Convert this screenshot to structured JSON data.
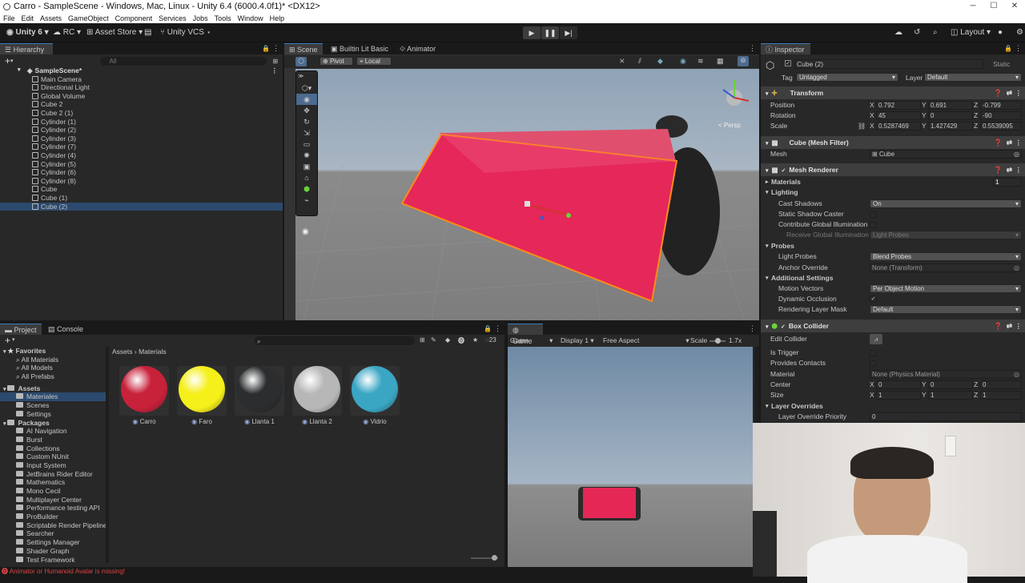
{
  "window": {
    "title": "Carro - SampleScene - Windows, Mac, Linux - Unity 6.4 (6000.4.0f1)* <DX12>"
  },
  "menu": [
    "File",
    "Edit",
    "Assets",
    "GameObject",
    "Component",
    "Services",
    "Jobs",
    "Tools",
    "Window",
    "Help"
  ],
  "toolbar": {
    "account": "Unity 6",
    "rc": "RC",
    "asset_store": "Asset Store",
    "vcs": "Unity VCS",
    "layout": "Layout"
  },
  "hierarchy": {
    "tab": "Hierarchy",
    "search_placeholder": "All",
    "scene": "SampleScene*",
    "items": [
      "Main Camera",
      "Directional Light",
      "Global Volume",
      "Cube 2",
      "Cube 2 (1)",
      "Cylinder (1)",
      "Cylinder (2)",
      "Cylinder (3)",
      "Cylinder (7)",
      "Cylinder (4)",
      "Cylinder (5)",
      "Cylinder (6)",
      "Cylinder (8)",
      "Cube",
      "Cube (1)",
      "Cube (2)"
    ]
  },
  "scene_view": {
    "tabs": [
      "Scene",
      "Builtin Lit Basic",
      "Animator"
    ],
    "pivot": "Pivot",
    "local": "Local",
    "persp": "< Persp"
  },
  "inspector": {
    "tab": "Inspector",
    "object_name": "Cube (2)",
    "static": "Static",
    "tag_label": "Tag",
    "tag": "Untagged",
    "layer_label": "Layer",
    "layer": "Default",
    "transform": {
      "title": "Transform",
      "position": {
        "label": "Position",
        "x": "0.792",
        "y": "0.691",
        "z": "-0.799"
      },
      "rotation": {
        "label": "Rotation",
        "x": "45",
        "y": "0",
        "z": "-90"
      },
      "scale": {
        "label": "Scale",
        "x": "0.5287469",
        "y": "1.427429",
        "z": "0.5539095"
      }
    },
    "mesh_filter": {
      "title": "Cube (Mesh Filter)",
      "mesh_label": "Mesh",
      "mesh": "Cube"
    },
    "mesh_renderer": {
      "title": "Mesh Renderer",
      "materials": "Materials",
      "materials_count": "1",
      "lighting": "Lighting",
      "cast_shadows_label": "Cast Shadows",
      "cast_shadows": "On",
      "static_shadow": "Static Shadow Caster",
      "contribute_gi": "Contribute Global Illumination",
      "receive_gi_label": "Receive Global Illumination",
      "receive_gi": "Light Probes",
      "probes": "Probes",
      "light_probes_label": "Light Probes",
      "light_probes": "Blend Probes",
      "anchor_label": "Anchor Override",
      "anchor": "None (Transform)",
      "additional": "Additional Settings",
      "motion_label": "Motion Vectors",
      "motion": "Per Object Motion",
      "dynamic_occlusion": "Dynamic Occlusion",
      "rendering_layer_label": "Rendering Layer Mask",
      "rendering_layer": "Default"
    },
    "box_collider": {
      "title": "Box Collider",
      "edit_collider": "Edit Collider",
      "is_trigger": "Is Trigger",
      "provides_contacts": "Provides Contacts",
      "material_label": "Material",
      "material": "None (Physics Material)",
      "center": {
        "label": "Center",
        "x": "0",
        "y": "0",
        "z": "0"
      },
      "size": {
        "label": "Size",
        "x": "1",
        "y": "1",
        "z": "1"
      },
      "layer_overrides": "Layer Overrides",
      "override_priority_label": "Layer Override Priority",
      "override_priority": "0"
    }
  },
  "project": {
    "tabs": [
      "Project",
      "Console"
    ],
    "breadcrumb": [
      "Assets",
      "Materials"
    ],
    "count": "23",
    "favorites": {
      "label": "Favorites",
      "items": [
        "All Materials",
        "All Models",
        "All Prefabs"
      ]
    },
    "assets": {
      "label": "Assets",
      "items": [
        "Materiales",
        "Scenes",
        "Settings"
      ]
    },
    "packages": {
      "label": "Packages",
      "items": [
        "AI Navigation",
        "Burst",
        "Collections",
        "Custom NUnit",
        "Input System",
        "JetBrains Rider Editor",
        "Mathematics",
        "Mono Cecil",
        "Multiplayer Center",
        "Performance testing API",
        "ProBuilder",
        "Scriptable Render Pipeline",
        "Searcher",
        "Settings Manager",
        "Shader Graph",
        "Test Framework"
      ]
    },
    "materials": [
      {
        "name": "Carro",
        "color": "#c8213a"
      },
      {
        "name": "Faro",
        "color": "#f5ef1a"
      },
      {
        "name": "Llanta 1",
        "color": "#2b2d2f"
      },
      {
        "name": "Llanta 2",
        "color": "#b7b7b7"
      },
      {
        "name": "Vidrio",
        "color": "#3aa6c4"
      }
    ]
  },
  "game_view": {
    "tab": "Game",
    "mode": "Game",
    "display": "Display 1",
    "aspect": "Free Aspect",
    "scale_label": "Scale",
    "scale": "1.7x"
  },
  "status": {
    "error": "Animator or Humanoid Avatar is missing!"
  }
}
